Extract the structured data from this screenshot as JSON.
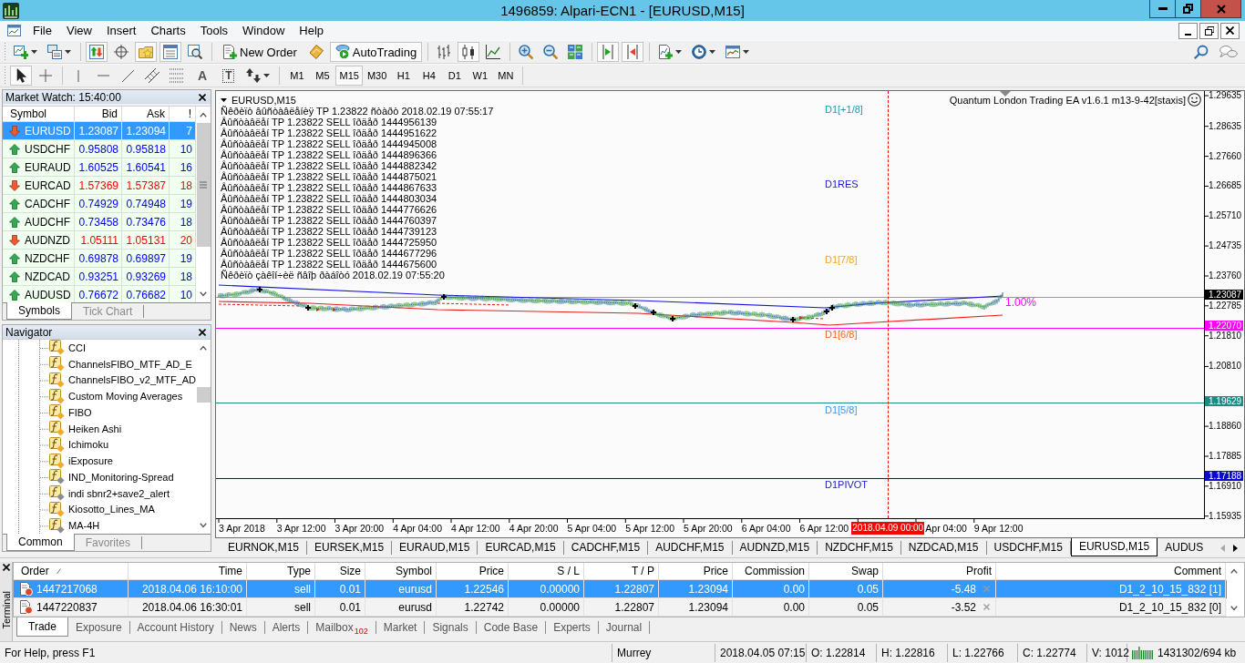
{
  "window": {
    "title": "1496859: Alpari-ECN1 - [EURUSD,M15]"
  },
  "menu": [
    "File",
    "View",
    "Insert",
    "Charts",
    "Tools",
    "Window",
    "Help"
  ],
  "toolbar": [
    [
      {
        "kind": "newchart",
        "pressed": false
      },
      {
        "kind": "profiles",
        "pressed": false
      }
    ],
    [
      {
        "kind": "marketwatch",
        "pressed": true
      },
      {
        "kind": "datawindow",
        "pressed": false
      },
      {
        "kind": "navigator",
        "pressed": true
      },
      {
        "kind": "terminal",
        "pressed": true
      },
      {
        "kind": "tester",
        "pressed": false
      }
    ],
    [
      {
        "kind": "neworder",
        "label": "New Order",
        "pressed": false
      },
      {
        "kind": "editor",
        "pressed": false
      },
      {
        "kind": "autotrading",
        "label": "AutoTrading",
        "pressed": true
      }
    ],
    [
      {
        "kind": "barchart",
        "pressed": false
      },
      {
        "kind": "candles",
        "pressed": true
      },
      {
        "kind": "linechart",
        "pressed": false
      }
    ],
    [
      {
        "kind": "zoomin",
        "pressed": false
      },
      {
        "kind": "zoomout",
        "pressed": false
      },
      {
        "kind": "tile",
        "pressed": false
      }
    ],
    [
      {
        "kind": "autoscroll",
        "pressed": true
      },
      {
        "kind": "shift",
        "pressed": true
      }
    ],
    [
      {
        "kind": "indicators",
        "pressed": false
      },
      {
        "kind": "periods",
        "pressed": false
      },
      {
        "kind": "templates",
        "pressed": false
      }
    ]
  ],
  "drawing_toolbar": [
    [
      {
        "kind": "cursor",
        "pressed": true
      },
      {
        "kind": "crosshair",
        "pressed": false
      }
    ],
    [
      {
        "kind": "vline",
        "pressed": false
      },
      {
        "kind": "hline",
        "pressed": false
      },
      {
        "kind": "trendline",
        "pressed": false
      },
      {
        "kind": "channel",
        "pressed": false
      },
      {
        "kind": "fibo",
        "pressed": false
      },
      {
        "kind": "text",
        "label": "A",
        "pressed": false
      },
      {
        "kind": "label",
        "label": "T",
        "pressed": false
      },
      {
        "kind": "arrows",
        "pressed": false
      }
    ]
  ],
  "timeframes": [
    {
      "label": "M1",
      "selected": false
    },
    {
      "label": "M5",
      "selected": false
    },
    {
      "label": "M15",
      "selected": true
    },
    {
      "label": "M30",
      "selected": false
    },
    {
      "label": "H1",
      "selected": false
    },
    {
      "label": "H4",
      "selected": false
    },
    {
      "label": "D1",
      "selected": false
    },
    {
      "label": "W1",
      "selected": false
    },
    {
      "label": "MN",
      "selected": false
    }
  ],
  "market_watch": {
    "title": "Market Watch: 15:40:00",
    "columns": [
      "Symbol",
      "Bid",
      "Ask",
      "!"
    ],
    "rows": [
      {
        "symbol": "EURUSD",
        "bid": "1.23087",
        "ask": "1.23094",
        "spread": "7",
        "up": false,
        "selected": true
      },
      {
        "symbol": "USDCHF",
        "bid": "0.95808",
        "ask": "0.95818",
        "spread": "10",
        "up": true,
        "selected": false
      },
      {
        "symbol": "EURAUD",
        "bid": "1.60525",
        "ask": "1.60541",
        "spread": "16",
        "up": true,
        "selected": false
      },
      {
        "symbol": "EURCAD",
        "bid": "1.57369",
        "ask": "1.57387",
        "spread": "18",
        "up": false,
        "selected": false
      },
      {
        "symbol": "CADCHF",
        "bid": "0.74929",
        "ask": "0.74948",
        "spread": "19",
        "up": true,
        "selected": false
      },
      {
        "symbol": "AUDCHF",
        "bid": "0.73458",
        "ask": "0.73476",
        "spread": "18",
        "up": true,
        "selected": false
      },
      {
        "symbol": "AUDNZD",
        "bid": "1.05111",
        "ask": "1.05131",
        "spread": "20",
        "up": false,
        "selected": false
      },
      {
        "symbol": "NZDCHF",
        "bid": "0.69878",
        "ask": "0.69897",
        "spread": "19",
        "up": true,
        "selected": false
      },
      {
        "symbol": "NZDCAD",
        "bid": "0.93251",
        "ask": "0.93269",
        "spread": "18",
        "up": true,
        "selected": false
      },
      {
        "symbol": "AUDUSD",
        "bid": "0.76672",
        "ask": "0.76682",
        "spread": "10",
        "up": true,
        "selected": false
      }
    ],
    "tabs": [
      {
        "label": "Symbols",
        "selected": true
      },
      {
        "label": "Tick Chart",
        "selected": false
      }
    ]
  },
  "navigator": {
    "title": "Navigator",
    "items": [
      {
        "label": "CCI",
        "color": "#f0a830"
      },
      {
        "label": "ChannelsFIBO_MTF_AD_E",
        "color": "#f0a830"
      },
      {
        "label": "ChannelsFIBO_v2_MTF_AD",
        "color": "#f0a830"
      },
      {
        "label": "Custom Moving Averages",
        "color": "#f0a830"
      },
      {
        "label": "FIBO",
        "color": "#f0a830"
      },
      {
        "label": "Heiken Ashi",
        "color": "#f0a830"
      },
      {
        "label": "Ichimoku",
        "color": "#f0a830"
      },
      {
        "label": "iExposure",
        "color": "#f0a830"
      },
      {
        "label": "IND_Monitoring-Spread",
        "color": "#8c8c8c"
      },
      {
        "label": "indi sbnr2+save2_alert",
        "color": "#8c8c8c"
      },
      {
        "label": "Kiosotto_Lines_MA",
        "color": "#f0a830"
      },
      {
        "label": "MA-4H",
        "color": "#8c8c8c"
      }
    ],
    "tabs": [
      {
        "label": "Common",
        "selected": true
      },
      {
        "label": "Favorites",
        "selected": false
      }
    ]
  },
  "chart": {
    "symbol": "EURUSD,M15",
    "comments": [
      "Ñêðèïò âûñòàâëåíèÿ TP 1.23822 ñòàðò 2018.02.19 07:55:17",
      "Âûñòàâëåí TP 1.23822 SELL îðäåð 1444956139",
      "Âûñòàâëåí TP 1.23822 SELL îðäåð 1444951622",
      "Âûñòàâëåí TP 1.23822 SELL îðäåð 1444945008",
      "Âûñòàâëåí TP 1.23822 SELL îðäåð 1444896366",
      "Âûñòàâëåí TP 1.23822 SELL îðäåð 1444882342",
      "Âûñòàâëåí TP 1.23822 SELL îðäåð 1444875021",
      "Âûñòàâëåí TP 1.23822 SELL îðäåð 1444867633",
      "Âûñòàâëåí TP 1.23822 SELL îðäåð 1444803034",
      "Âûñòàâëåí TP 1.23822 SELL îðäåð 1444776626",
      "Âûñòàâëåí TP 1.23822 SELL îðäåð 1444760397",
      "Âûñòàâëåí TP 1.23822 SELL îðäåð 1444739123",
      "Âûñòàâëåí TP 1.23822 SELL îðäåð 1444725950",
      "Âûñòàâëåí TP 1.23822 SELL îðäåð 1444677296",
      "Âûñòàâëåí TP 1.23822 SELL îðäåð 1444675600",
      "Ñêðèïò çàêîí÷èë ñâîþ ðàáîòó 2018.02.19 07:55:20"
    ],
    "expert": "Quantum London Trading EA v1.6.1 m13-9-42[staxis]",
    "y_axis": [
      "1.29635",
      "1.28635",
      "1.27660",
      "1.26685",
      "1.25710",
      "1.24735",
      "1.23760",
      "1.22785",
      "1.21810",
      "1.20810",
      "1.18860",
      "1.17885",
      "1.16910",
      "1.15935"
    ],
    "x_axis": [
      {
        "label": "3 Apr 2018",
        "kind": "tick"
      },
      {
        "label": "3 Apr 12:00",
        "kind": "tick"
      },
      {
        "label": "3 Apr 20:00",
        "kind": "tick"
      },
      {
        "label": "4 Apr 04:00",
        "kind": "tick"
      },
      {
        "label": "4 Apr 12:00",
        "kind": "tick"
      },
      {
        "label": "4 Apr 20:00",
        "kind": "tick"
      },
      {
        "label": "5 Apr 04:00",
        "kind": "tick"
      },
      {
        "label": "5 Apr 12:00",
        "kind": "tick"
      },
      {
        "label": "5 Apr 20:00",
        "kind": "tick"
      },
      {
        "label": "6 Apr 04:00",
        "kind": "tick"
      },
      {
        "label": "6 Apr 12:00",
        "kind": "tick"
      },
      {
        "label": "2018.04.09 00:00",
        "kind": "cursor"
      },
      {
        "label": "Apr 04:00",
        "kind": "tick"
      },
      {
        "label": "9 Apr 12:00",
        "kind": "tick"
      }
    ],
    "levels": [
      {
        "kind": "bid",
        "price": "1.23087",
        "color": "#000000"
      },
      {
        "kind": "level",
        "price": "1.22070",
        "color": "#ff00ff"
      },
      {
        "kind": "level",
        "price": "1.19629",
        "color": "#1a8c84"
      },
      {
        "kind": "level",
        "price": "1.17188",
        "color": "#0a0acc"
      }
    ],
    "level_labels": [
      {
        "label": "D1[+1/8]",
        "color": "#1e9bb0"
      },
      {
        "label": "D1RES",
        "color": "#1c1ccc"
      },
      {
        "label": "D1[7/8]",
        "color": "#f5a623"
      },
      {
        "label": "D1[6/8]",
        "color": "#f26522"
      },
      {
        "label": "D1[5/8]",
        "color": "#3399ff"
      },
      {
        "label": "D1PIVOT",
        "color": "#2222bb"
      }
    ],
    "risk_label": "1.00%"
  },
  "chart_tabs": [
    {
      "label": "EURNOK,M15",
      "selected": false
    },
    {
      "label": "EURSEK,M15",
      "selected": false
    },
    {
      "label": "EURAUD,M15",
      "selected": false
    },
    {
      "label": "EURCAD,M15",
      "selected": false
    },
    {
      "label": "CADCHF,M15",
      "selected": false
    },
    {
      "label": "AUDCHF,M15",
      "selected": false
    },
    {
      "label": "AUDNZD,M15",
      "selected": false
    },
    {
      "label": "NZDCHF,M15",
      "selected": false
    },
    {
      "label": "NZDCAD,M15",
      "selected": false
    },
    {
      "label": "USDCHF,M15",
      "selected": false
    },
    {
      "label": "EURUSD,M15",
      "selected": true
    },
    {
      "label": "AUDUS",
      "selected": false
    }
  ],
  "chart_tab_scroll": [
    {
      "kind": "back",
      "disabled": true
    },
    {
      "kind": "forward",
      "disabled": false
    }
  ],
  "terminal": {
    "label": "Terminal",
    "columns": [
      "Order",
      "Time",
      "Type",
      "Size",
      "Symbol",
      "Price",
      "S / L",
      "T / P",
      "Price",
      "Commission",
      "Swap",
      "Profit",
      "Comment"
    ],
    "rows": [
      {
        "selected": true,
        "cells": [
          "1447217068",
          "2018.04.06 16:10:00",
          "sell",
          "0.01",
          "eurusd",
          "1.22546",
          "0.00000",
          "1.22807",
          "1.23094",
          "0.00",
          "0.05",
          "-5.48",
          "D1_2_10_15_832 [1]"
        ]
      },
      {
        "selected": false,
        "cells": [
          "1447220837",
          "2018.04.06 16:30:01",
          "sell",
          "0.01",
          "eurusd",
          "1.22742",
          "0.00000",
          "1.22807",
          "1.23094",
          "0.00",
          "0.05",
          "-3.52",
          "D1_2_10_15_832 [0]"
        ]
      }
    ],
    "tabs": [
      {
        "label": "Trade",
        "selected": true
      },
      {
        "label": "Exposure",
        "selected": false
      },
      {
        "label": "Account History",
        "selected": false
      },
      {
        "label": "News",
        "selected": false
      },
      {
        "label": "Alerts",
        "selected": false
      },
      {
        "label": "Mailbox",
        "badge": "102",
        "selected": false
      },
      {
        "label": "Market",
        "selected": false
      },
      {
        "label": "Signals",
        "selected": false
      },
      {
        "label": "Code Base",
        "selected": false
      },
      {
        "label": "Experts",
        "selected": false
      },
      {
        "label": "Journal",
        "selected": false
      }
    ]
  },
  "status_bar": {
    "help": "For Help, press F1",
    "sections": [
      "Murrey",
      "2018.04.05 07:15",
      "O: 1.22814",
      "H: 1.22816",
      "L: 1.22766",
      "C: 1.22774",
      "V: 1012"
    ],
    "memory": "1431302/694 kb"
  }
}
